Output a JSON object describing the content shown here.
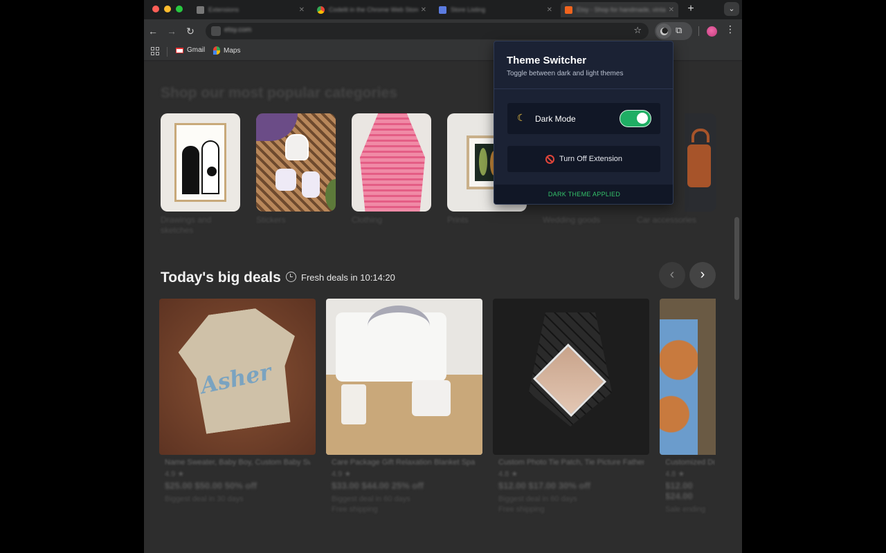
{
  "window": {
    "tabs": [
      {
        "title": "Extensions",
        "icon": "puzzle-icon",
        "active": false
      },
      {
        "title": "Codelit in the Chrome Web Store",
        "icon": "chrome-icon",
        "active": false
      },
      {
        "title": "Store Listing",
        "icon": "store-icon",
        "active": false
      },
      {
        "title": "Etsy - Shop for handmade, vintage",
        "icon": "etsy-icon",
        "active": true
      }
    ],
    "url": "etsy.com"
  },
  "bookmarks": [
    {
      "label": "Gmail",
      "icon": "gmail-icon"
    },
    {
      "label": "Maps",
      "icon": "maps-icon"
    }
  ],
  "page": {
    "categories_heading": "Shop our most popular categories",
    "categories": [
      "Drawings and sketches",
      "Stickers",
      "Clothing",
      "Prints",
      "Wedding goods",
      "Car accessories"
    ],
    "deals_title": "Today's big deals",
    "deals_timer": "Fresh deals in 10:14:20",
    "deals": [
      {
        "title": "Name Sweater, Baby Boy, Custom Baby Sweater",
        "rating": "4.9 ★",
        "price": "$25.00 $50.00 50% off",
        "shipping": "Biggest deal in 30 days"
      },
      {
        "title": "Care Package Gift Relaxation Blanket Spa Box",
        "rating": "4.9 ★",
        "price": "$33.00 $44.00 25% off",
        "shipping": "Biggest deal in 60 days",
        "extra": "Free shipping"
      },
      {
        "title": "Custom Photo Tie Patch, Tie Picture Father's Day",
        "rating": "4.8 ★",
        "price": "$12.00 $17.00 30% off",
        "shipping": "Biggest deal in 60 days",
        "extra": "Free shipping"
      },
      {
        "title": "Customized Dog Face Socks",
        "rating": "4.8 ★",
        "price": "$12.00 $24.00",
        "shipping": "Sale ending"
      }
    ]
  },
  "popup": {
    "title": "Theme Switcher",
    "subtitle": "Toggle between dark and light themes",
    "dark_mode_label": "Dark Mode",
    "dark_mode_on": true,
    "turn_off_label": "Turn Off Extension",
    "status": "DARK THEME APPLIED",
    "colors": {
      "background": "#1b2234",
      "toggle": "#1fae64",
      "status": "#34c36b",
      "danger": "#e0453a"
    }
  }
}
